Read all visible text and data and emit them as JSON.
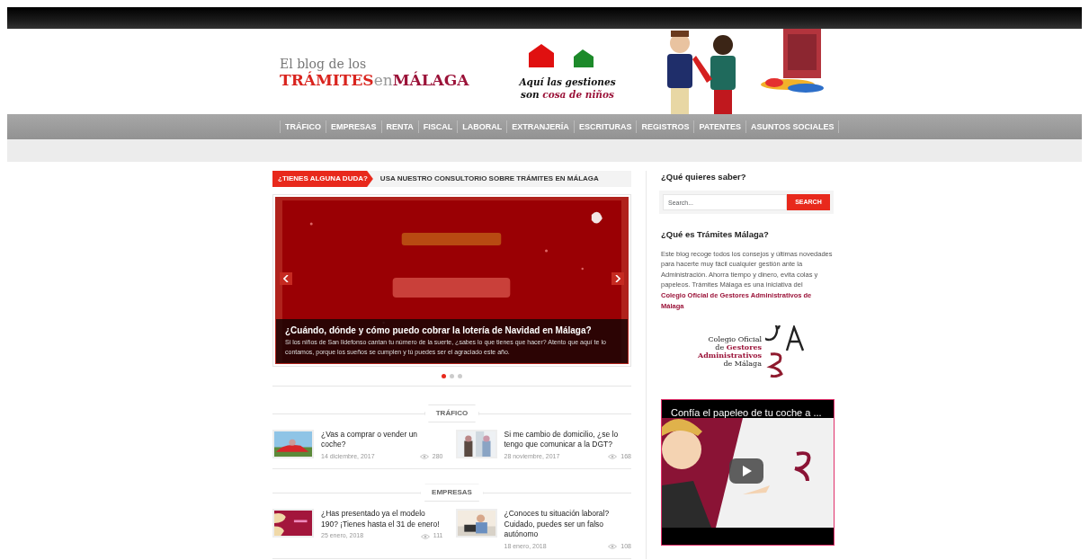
{
  "header": {
    "logo": {
      "line1": "El blog de los",
      "part1": "TRÁMITES",
      "part2": "en",
      "part3": "MÁLAGA"
    },
    "banner": {
      "tagline_1": "Aquí las gestiones",
      "tagline_2a": "son",
      "tagline_2b": "cosa de niños"
    }
  },
  "nav": [
    "TRÁFICO",
    "EMPRESAS",
    "RENTA",
    "FISCAL",
    "LABORAL",
    "EXTRANJERÍA",
    "ESCRITURAS",
    "REGISTROS",
    "PATENTES",
    "ASUNTOS SOCIALES"
  ],
  "ticker": {
    "label": "¿TIENES ALGUNA DUDA?",
    "text": "USA NUESTRO CONSULTORIO SOBRE TRÁMITES EN MÁLAGA"
  },
  "slider": {
    "title": "¿Cuándo, dónde y cómo puedo cobrar la lotería de Navidad en Málaga?",
    "excerpt": "Si los niños de San Ildefonso cantan tu número de la suerte, ¿sabes lo que tienes que hacer? Atento que aquí te lo contamos, porque los sueños se cumplen y tú puedes ser el agraciado este año.",
    "dots": [
      {
        "selected": true
      },
      {
        "selected": false
      },
      {
        "selected": false
      }
    ]
  },
  "sections": [
    {
      "title": "TRÁFICO",
      "posts": [
        {
          "title": "¿Vas a comprar o vender un coche?",
          "date": "14 diciembre, 2017",
          "views": "280"
        },
        {
          "title": "Si me cambio de domicilio, ¿se lo tengo que comunicar a la DGT?",
          "date": "28 noviembre, 2017",
          "views": "168"
        }
      ]
    },
    {
      "title": "EMPRESAS",
      "posts": [
        {
          "title": "¿Has presentado ya el modelo 190? ¡Tienes hasta el 31 de enero!",
          "date": "25 enero, 2018",
          "views": "111"
        },
        {
          "title": "¿Conoces tu situación laboral? Cuidado, puedes ser un falso autónomo",
          "date": "18 enero, 2018",
          "views": "108"
        }
      ]
    }
  ],
  "sidebar": {
    "search": {
      "heading": "¿Qué quieres saber?",
      "placeholder": "Search...",
      "button": "SEARCH"
    },
    "about": {
      "heading": "¿Qué es Trámites Málaga?",
      "text": "Este blog recoge todos los consejos y últimas novedades para hacerte muy fácil cualquier gestión ante la Administración. Ahorra tiempo y dinero, evita colas y papeleos. Trámites Málaga es una iniciativa del",
      "link": "Colegio Oficial de Gestores Administrativos de Málaga"
    },
    "org_logo": {
      "line1": "Colegio Oficial",
      "line2a": "de",
      "line2b": "Gestores",
      "line3": "Administrativos",
      "line4": "de Málaga"
    },
    "video": {
      "title": "Confía el papeleo de tu coche a ..."
    }
  }
}
